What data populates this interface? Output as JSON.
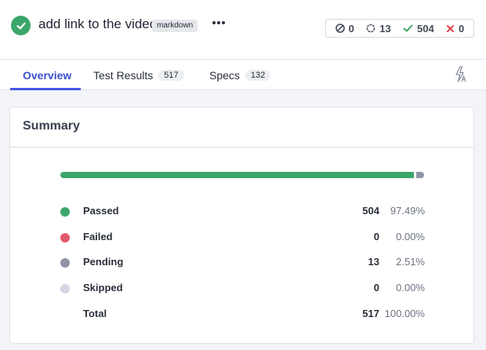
{
  "run": {
    "title": "add link to the video",
    "branch": "markdown"
  },
  "stats": {
    "skipped": "0",
    "pending": "13",
    "passed": "504",
    "failed": "0"
  },
  "tabs": [
    {
      "label": "Overview",
      "count": ""
    },
    {
      "label": "Test Results",
      "count": "517"
    },
    {
      "label": "Specs",
      "count": "132"
    }
  ],
  "summary": {
    "title": "Summary",
    "progress": {
      "passed_fraction": 0.9749,
      "pending_fraction": 0.0251
    },
    "rows": [
      {
        "label": "Passed",
        "count": "504",
        "percent": "97.49%",
        "color": "#3aa66b"
      },
      {
        "label": "Failed",
        "count": "0",
        "percent": "0.00%",
        "color": "#e35a6e"
      },
      {
        "label": "Pending",
        "count": "13",
        "percent": "2.51%",
        "color": "#8e93a6"
      },
      {
        "label": "Skipped",
        "count": "0",
        "percent": "0.00%",
        "color": "#d3d6e2"
      },
      {
        "label": "Total",
        "count": "517",
        "percent": "100.00%",
        "color": ""
      }
    ]
  },
  "icons": {
    "status": "check-circle-icon",
    "more": "ellipsis-icon",
    "skipped": "cancel-circle-icon",
    "pending": "ring-icon",
    "passed": "checkmark-icon",
    "failed": "x-icon",
    "flaky": "flaky-bolt-icon"
  }
}
